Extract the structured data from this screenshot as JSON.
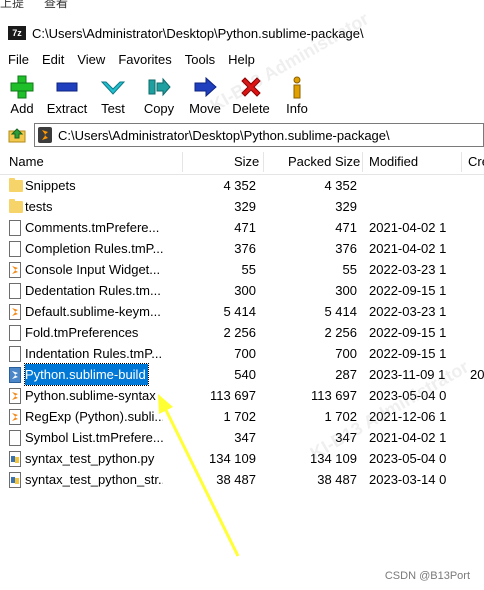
{
  "top_strip": [
    "上提",
    "查看"
  ],
  "window": {
    "title": "C:\\Users\\Administrator\\Desktop\\Python.sublime-package\\",
    "app_icon": "7z"
  },
  "menu": [
    "File",
    "Edit",
    "View",
    "Favorites",
    "Tools",
    "Help"
  ],
  "toolbar": [
    {
      "label": "Add",
      "icon": "plus-icon",
      "color": "#1fbf2a"
    },
    {
      "label": "Extract",
      "icon": "minus-icon",
      "color": "#1f3fbf"
    },
    {
      "label": "Test",
      "icon": "check-icon",
      "color": "#20c0d0"
    },
    {
      "label": "Copy",
      "icon": "copy-arrow-icon",
      "color": "#1fa0a0"
    },
    {
      "label": "Move",
      "icon": "move-arrow-icon",
      "color": "#1f3fbf"
    },
    {
      "label": "Delete",
      "icon": "delete-x-icon",
      "color": "#e01010"
    },
    {
      "label": "Info",
      "icon": "info-icon",
      "color": "#e0a000"
    }
  ],
  "address": {
    "path": "C:\\Users\\Administrator\\Desktop\\Python.sublime-package\\"
  },
  "columns": {
    "name": "Name",
    "size": "Size",
    "packed": "Packed Size",
    "modified": "Modified",
    "created": "Cre"
  },
  "files": [
    {
      "name": "Snippets",
      "size": "4 352",
      "packed": "4 352",
      "modified": "",
      "created": "",
      "type": "folder"
    },
    {
      "name": "tests",
      "size": "329",
      "packed": "329",
      "modified": "",
      "created": "",
      "type": "folder"
    },
    {
      "name": "Comments.tmPrefere...",
      "size": "471",
      "packed": "471",
      "modified": "2021-04-02 1",
      "created": "",
      "type": "doc"
    },
    {
      "name": "Completion Rules.tmP...",
      "size": "376",
      "packed": "376",
      "modified": "2021-04-02 1",
      "created": "",
      "type": "doc"
    },
    {
      "name": "Console Input Widget...",
      "size": "55",
      "packed": "55",
      "modified": "2022-03-23 1",
      "created": "",
      "type": "sub"
    },
    {
      "name": "Dedentation Rules.tm...",
      "size": "300",
      "packed": "300",
      "modified": "2022-09-15 1",
      "created": "",
      "type": "doc"
    },
    {
      "name": "Default.sublime-keym...",
      "size": "5 414",
      "packed": "5 414",
      "modified": "2022-03-23 1",
      "created": "",
      "type": "sub"
    },
    {
      "name": "Fold.tmPreferences",
      "size": "2 256",
      "packed": "2 256",
      "modified": "2022-09-15 1",
      "created": "",
      "type": "doc"
    },
    {
      "name": "Indentation Rules.tmP...",
      "size": "700",
      "packed": "700",
      "modified": "2022-09-15 1",
      "created": "",
      "type": "doc"
    },
    {
      "name": "Python.sublime-build",
      "size": "540",
      "packed": "287",
      "modified": "2023-11-09 1",
      "created": "20",
      "type": "build",
      "selected": true
    },
    {
      "name": "Python.sublime-syntax",
      "size": "113 697",
      "packed": "113 697",
      "modified": "2023-05-04 0",
      "created": "",
      "type": "sub"
    },
    {
      "name": "RegExp (Python).subli...",
      "size": "1 702",
      "packed": "1 702",
      "modified": "2021-12-06 1",
      "created": "",
      "type": "sub"
    },
    {
      "name": "Symbol List.tmPrefere...",
      "size": "347",
      "packed": "347",
      "modified": "2021-04-02 1",
      "created": "",
      "type": "doc"
    },
    {
      "name": "syntax_test_python.py",
      "size": "134 109",
      "packed": "134 109",
      "modified": "2023-05-04 0",
      "created": "",
      "type": "py"
    },
    {
      "name": "syntax_test_python_str...",
      "size": "38 487",
      "packed": "38 487",
      "modified": "2023-03-14 0",
      "created": "",
      "type": "py"
    }
  ],
  "watermark": "CSDN @B13Port",
  "faint_watermark": "KI-B13 Administrator",
  "arrow_color": "#ffff33"
}
